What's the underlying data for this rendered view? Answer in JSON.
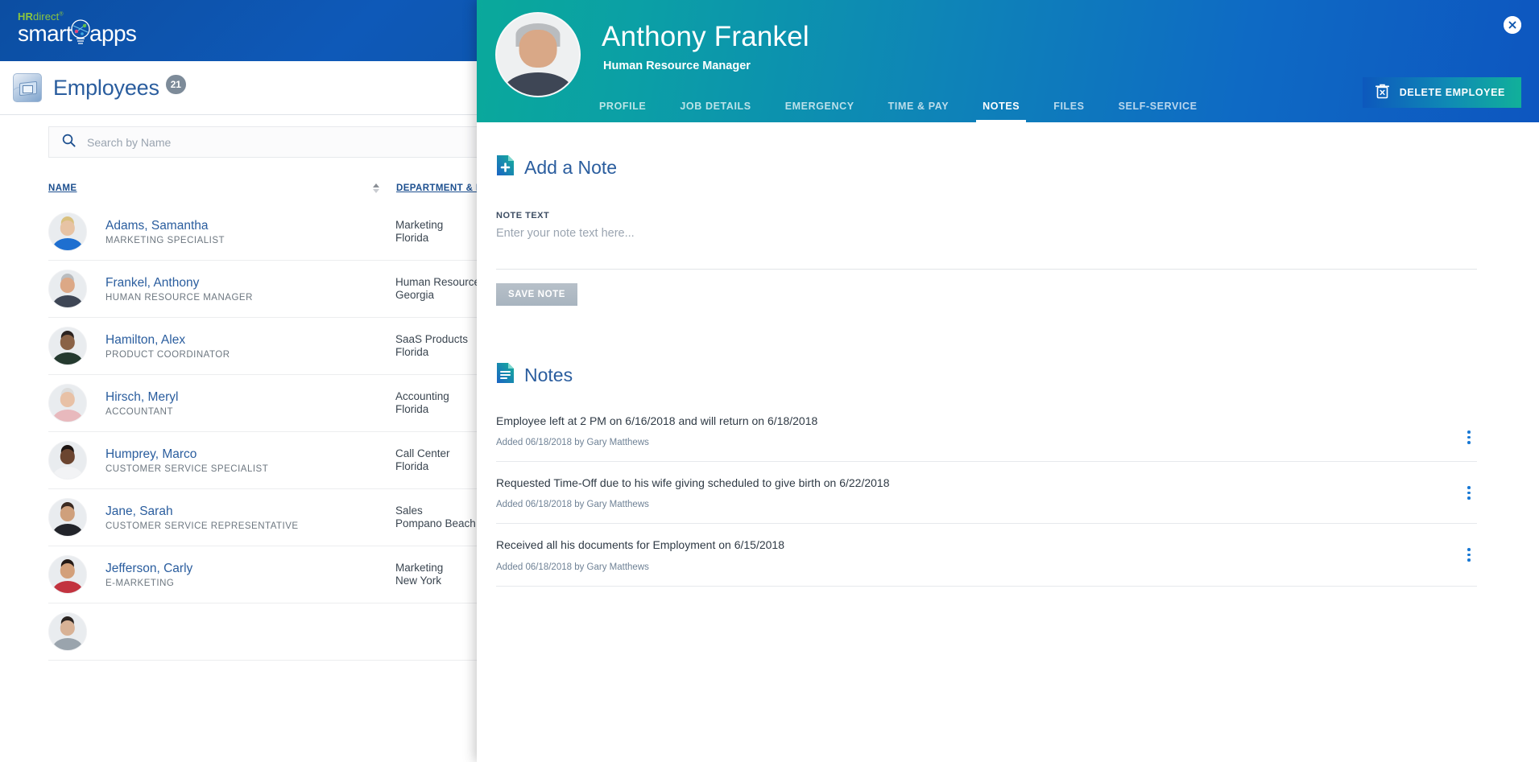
{
  "brand": {
    "hr": "HR",
    "direct": "direct",
    "tm": "®",
    "smart": "smart",
    "apps": "apps",
    "bulb_icon": "lightbulb-icon"
  },
  "page": {
    "title": "Employees",
    "count": "21",
    "icon": "employee-folder-icon"
  },
  "search": {
    "placeholder": "Search by Name",
    "value": "",
    "icon": "search-icon"
  },
  "list": {
    "columns": {
      "name": "NAME",
      "department": "DEPARTMENT & LOCATION"
    },
    "rows": [
      {
        "name": "Adams, Samantha",
        "title": "MARKETING SPECIALIST",
        "department": "Marketing",
        "location": "Florida",
        "hair": "#d9c07e",
        "skin": "#e7c3a4",
        "shirt": "#1e6fd0"
      },
      {
        "name": "Frankel, Anthony",
        "title": "HUMAN RESOURCE MANAGER",
        "department": "Human Resource",
        "location": "Georgia",
        "hair": "#b9bcbf",
        "skin": "#dca886",
        "shirt": "#3e4655"
      },
      {
        "name": "Hamilton, Alex",
        "title": "PRODUCT COORDINATOR",
        "department": "SaaS Products",
        "location": "Florida",
        "hair": "#2b2320",
        "skin": "#8a6246",
        "shirt": "#253a2f"
      },
      {
        "name": "Hirsch, Meryl",
        "title": "ACCOUNTANT",
        "department": "Accounting",
        "location": "Florida",
        "hair": "#dcdcdc",
        "skin": "#e8c1a6",
        "shirt": "#e8b9bd"
      },
      {
        "name": "Humprey, Marco",
        "title": "CUSTOMER SERVICE SPECIALIST",
        "department": "Call Center",
        "location": "Florida",
        "hair": "#1d1512",
        "skin": "#6b4530",
        "shirt": "#f2f3f5"
      },
      {
        "name": "Jane, Sarah",
        "title": "CUSTOMER SERVICE REPRESENTATIVE",
        "department": "Sales",
        "location": "Pompano Beach",
        "hair": "#3b2a22",
        "skin": "#cfa07c",
        "shirt": "#22242a"
      },
      {
        "name": "Jefferson, Carly",
        "title": "E-MARKETING",
        "department": "Marketing",
        "location": "New York",
        "hair": "#241a16",
        "skin": "#d3a07a",
        "shirt": "#c2333f"
      },
      {
        "name": "",
        "title": "",
        "department": "",
        "location": "",
        "hair": "#2a2320",
        "skin": "#d8b296",
        "shirt": "#9aa4ad"
      }
    ]
  },
  "modal": {
    "close_icon": "close-icon",
    "avatar": "employee-avatar",
    "employee_name": "Anthony Frankel",
    "employee_role": "Human Resource Manager",
    "tabs": [
      {
        "label": "PROFILE",
        "active": false
      },
      {
        "label": "JOB DETAILS",
        "active": false
      },
      {
        "label": "EMERGENCY",
        "active": false
      },
      {
        "label": "TIME & PAY",
        "active": false
      },
      {
        "label": "NOTES",
        "active": true
      },
      {
        "label": "FILES",
        "active": false
      },
      {
        "label": "SELF-SERVICE",
        "active": false
      }
    ],
    "delete_button": {
      "label": "DELETE EMPLOYEE",
      "icon": "trash-delete-icon"
    },
    "add_note": {
      "heading": "Add a Note",
      "icon": "document-add-icon",
      "field_label": "NOTE TEXT",
      "placeholder": "Enter your note text here...",
      "value": "",
      "save_label": "SAVE NOTE"
    },
    "notes": {
      "heading": "Notes",
      "icon": "document-lines-icon",
      "items": [
        {
          "text": "Employee left at 2 PM on 6/16/2018 and will return on 6/18/2018",
          "meta": "Added 06/18/2018 by Gary Matthews",
          "menu_icon": "kebab-menu-icon"
        },
        {
          "text": "Requested Time-Off due to his wife giving scheduled to give birth on 6/22/2018",
          "meta": "Added 06/18/2018 by Gary Matthews",
          "menu_icon": "kebab-menu-icon"
        },
        {
          "text": "Received all his documents for Employment on 6/15/2018",
          "meta": "Added 06/18/2018 by Gary Matthews",
          "menu_icon": "kebab-menu-icon"
        }
      ]
    }
  },
  "colors": {
    "brand_blue": "#0c4ea2",
    "accent_teal": "#0aa99b",
    "accent_blue": "#0d56c0",
    "link_blue": "#2a5d9e",
    "badge_gray": "#7d8b99"
  }
}
